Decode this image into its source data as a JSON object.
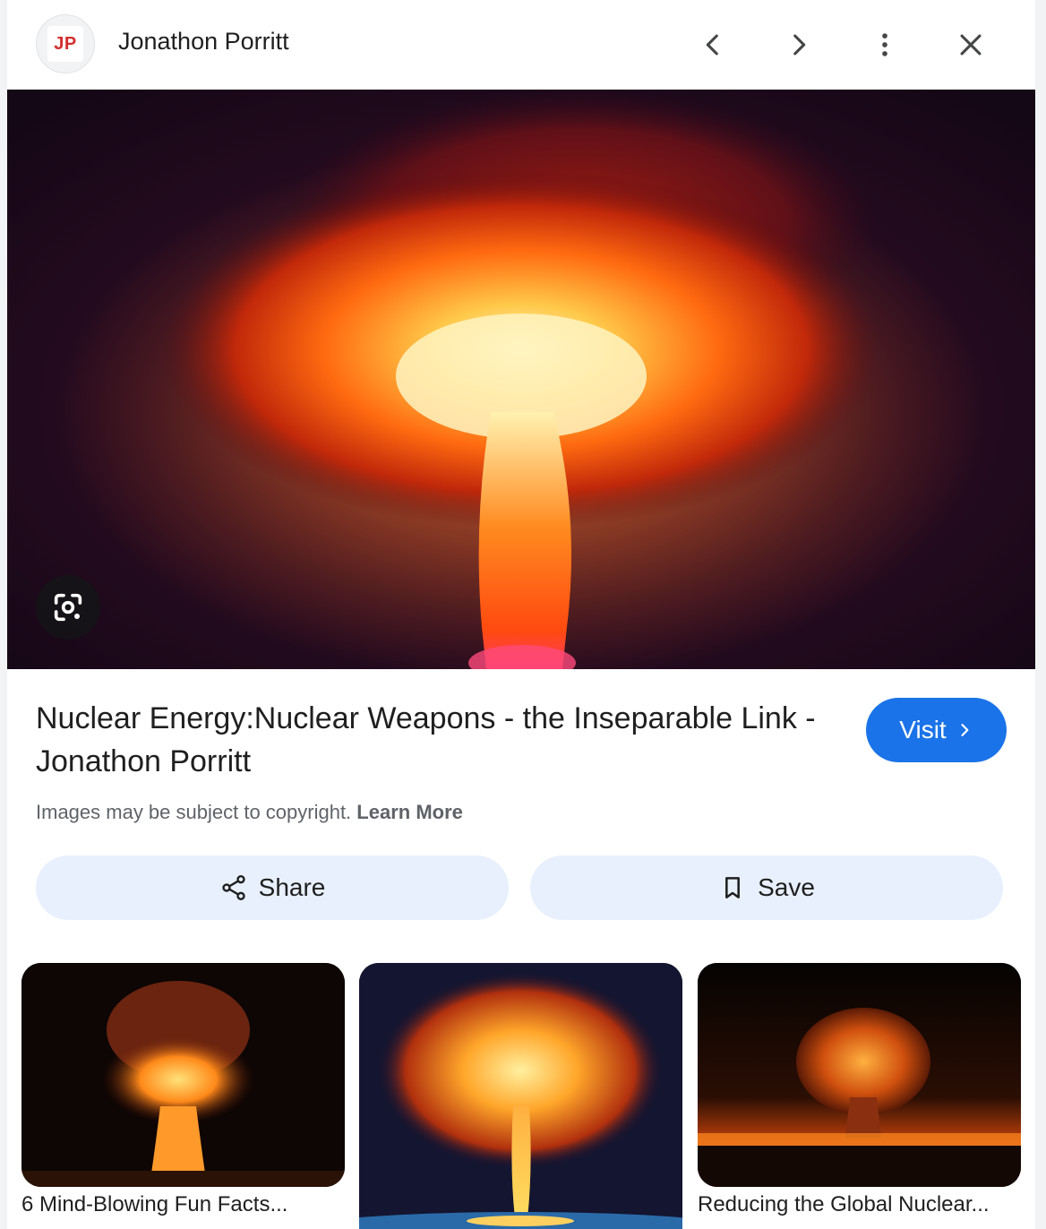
{
  "header": {
    "favicon_text": "JP",
    "site_name": "Jonathon Porritt",
    "icons": [
      "chevron-left-icon",
      "chevron-right-icon",
      "more-vert-icon",
      "close-icon"
    ]
  },
  "hero": {
    "lens_icon": "google-lens-icon"
  },
  "result": {
    "title": "Nuclear Energy:Nuclear Weapons - the Inseparable Link - Jonathon Porritt",
    "visit_label": "Visit",
    "copyright_text": "Images may be subject to copyright.",
    "learn_more": "Learn More"
  },
  "actions": {
    "share_label": "Share",
    "save_label": "Save"
  },
  "related": [
    {
      "label": "6 Mind-Blowing Fun Facts..."
    },
    {
      "label": ""
    },
    {
      "label": "Reducing the Global Nuclear..."
    }
  ],
  "colors": {
    "accent": "#1a73e8",
    "action_bg": "#e8f0fe",
    "favicon_red": "#d32f2f"
  }
}
